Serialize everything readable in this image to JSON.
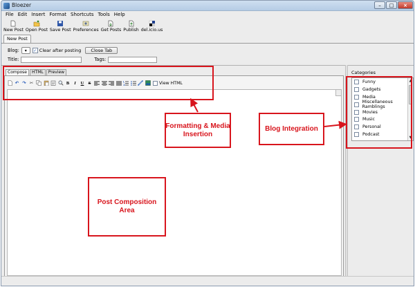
{
  "window": {
    "title": "Bloezer",
    "controls": {
      "minimize": "–",
      "maximize": "□",
      "close": "×"
    }
  },
  "menu": [
    "File",
    "Edit",
    "Insert",
    "Format",
    "Shortcuts",
    "Tools",
    "Help"
  ],
  "toolbar": {
    "buttons": [
      {
        "label": "New Post",
        "icon": "new-post-icon"
      },
      {
        "label": "Open Post",
        "icon": "open-post-icon"
      },
      {
        "label": "Save Post",
        "icon": "save-post-icon"
      },
      {
        "label": "Preferences",
        "icon": "preferences-icon"
      },
      {
        "label": "Get Posts",
        "icon": "get-posts-icon"
      },
      {
        "label": "Publish",
        "icon": "publish-icon"
      },
      {
        "label": "del.icio.us",
        "icon": "delicious-icon"
      }
    ]
  },
  "document_tab": "New Post",
  "post_form": {
    "blog_label": "Blog:",
    "blog_select_value": "▾",
    "clear_after_posting": {
      "label": "Clear after posting",
      "checked": true
    },
    "close_tab_button": "Close Tab",
    "title_label": "Title:",
    "title_value": "",
    "tags_label": "Tags:",
    "tags_value": ""
  },
  "compose_tabs": [
    "Compose",
    "HTML",
    "Preview"
  ],
  "formatting_toolbar": {
    "buttons": [
      {
        "name": "new-doc-icon",
        "glyph": ""
      },
      {
        "name": "undo-icon",
        "glyph": "↶"
      },
      {
        "name": "redo-icon",
        "glyph": "↷"
      },
      {
        "name": "cut-icon",
        "glyph": "✂"
      },
      {
        "name": "copy-icon",
        "glyph": ""
      },
      {
        "name": "paste-icon",
        "glyph": ""
      },
      {
        "name": "paste-special-icon",
        "glyph": ""
      },
      {
        "name": "find-icon",
        "glyph": ""
      },
      {
        "name": "bold-icon",
        "glyph": "B"
      },
      {
        "name": "italic-icon",
        "glyph": "I"
      },
      {
        "name": "underline-icon",
        "glyph": "U"
      },
      {
        "name": "strikethrough-icon",
        "glyph": "S"
      },
      {
        "name": "align-left-icon",
        "glyph": ""
      },
      {
        "name": "align-center-icon",
        "glyph": ""
      },
      {
        "name": "align-right-icon",
        "glyph": ""
      },
      {
        "name": "justify-icon",
        "glyph": ""
      },
      {
        "name": "ordered-list-icon",
        "glyph": ""
      },
      {
        "name": "unordered-list-icon",
        "glyph": ""
      },
      {
        "name": "insert-link-icon",
        "glyph": ""
      },
      {
        "name": "insert-image-icon",
        "glyph": ""
      }
    ],
    "view_html_label": "View HTML"
  },
  "categories": {
    "title": "Categories",
    "items": [
      "Funny",
      "Gadgets",
      "Media",
      "Miscellaneous Ramblings",
      "Movies",
      "Music",
      "Personal",
      "Podcast"
    ]
  },
  "annotations": {
    "formatting": "Formatting & Media Insertion",
    "blog_integration": "Blog Integration",
    "post_composition": "Post Composition Area"
  },
  "colors": {
    "callout_red": "#d8141c",
    "window_bg": "#ececec",
    "titlebar": "#c2d6ec"
  }
}
